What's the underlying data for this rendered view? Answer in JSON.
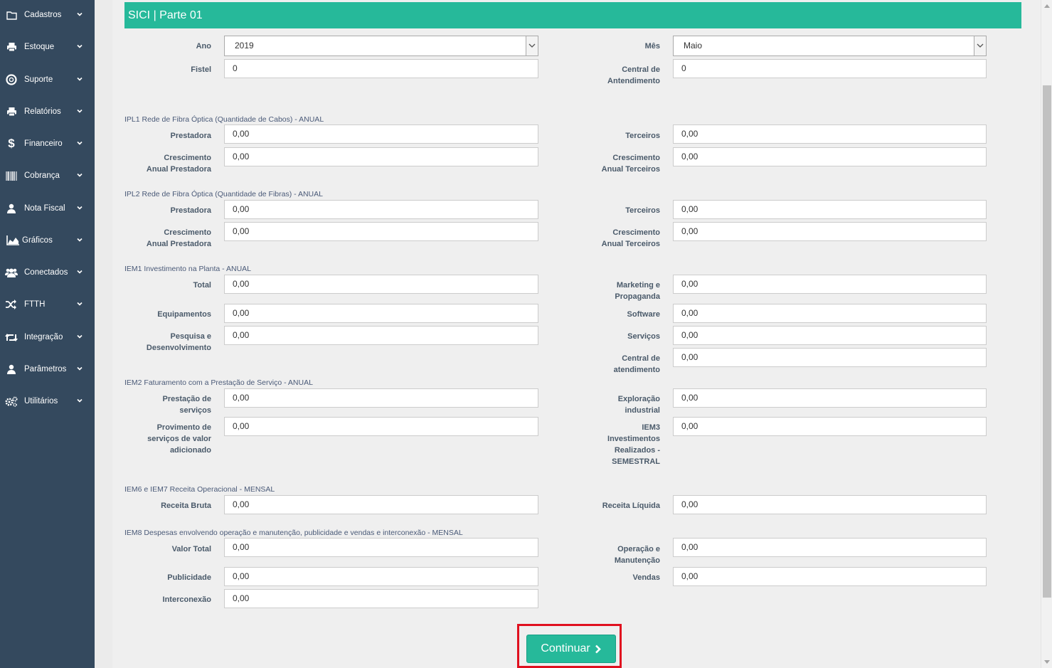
{
  "sidebar": {
    "items": [
      {
        "label": "Cadastros",
        "icon": "folder-icon"
      },
      {
        "label": "Estoque",
        "icon": "print-icon"
      },
      {
        "label": "Suporte",
        "icon": "life-ring-icon"
      },
      {
        "label": "Relatórios",
        "icon": "print-icon"
      },
      {
        "label": "Financeiro",
        "icon": "dollar-icon"
      },
      {
        "label": "Cobrança",
        "icon": "barcode-icon"
      },
      {
        "label": "Nota Fiscal",
        "icon": "user-icon"
      },
      {
        "label": "Gráficos",
        "icon": "area-chart-icon"
      },
      {
        "label": "Conectados",
        "icon": "users-icon"
      },
      {
        "label": "FTTH",
        "icon": "random-icon"
      },
      {
        "label": "Integração",
        "icon": "retweet-icon"
      },
      {
        "label": "Parâmetros",
        "icon": "user-icon"
      },
      {
        "label": "Utilitários",
        "icon": "cogs-icon"
      }
    ]
  },
  "panel": {
    "title": "SICI | Parte 01"
  },
  "form": {
    "ano": {
      "label": "Ano",
      "value": "2019"
    },
    "mes": {
      "label": "Mês",
      "value": "Maio"
    },
    "fistel": {
      "label": "Fistel",
      "value": "0"
    },
    "central": {
      "label_1": "Central de",
      "label_2": "Antendimento",
      "value": "0"
    },
    "ipl1": {
      "section": "IPL1 Rede de Fibra Óptica (Quantidade de Cabos) - ANUAL",
      "prestadora": {
        "label": "Prestadora",
        "value": "0,00"
      },
      "terceiros": {
        "label": "Terceiros",
        "value": "0,00"
      },
      "cresc_prest": {
        "label_1": "Crescimento",
        "label_2": "Anual Prestadora",
        "value": "0,00"
      },
      "cresc_terc": {
        "label_1": "Crescimento",
        "label_2": "Anual Terceiros",
        "value": "0,00"
      }
    },
    "ipl2": {
      "section": "IPL2 Rede de Fibra Óptica (Quantidade de Fibras) - ANUAL",
      "prestadora": {
        "label": "Prestadora",
        "value": "0,00"
      },
      "terceiros": {
        "label": "Terceiros",
        "value": "0,00"
      },
      "cresc_prest": {
        "label_1": "Crescimento",
        "label_2": "Anual Prestadora",
        "value": "0,00"
      },
      "cresc_terc": {
        "label_1": "Crescimento",
        "label_2": "Anual Terceiros",
        "value": "0,00"
      }
    },
    "iem1": {
      "section": "IEM1 Investimento na Planta - ANUAL",
      "total": {
        "label": "Total",
        "value": "0,00"
      },
      "marketing": {
        "label_1": "Marketing e",
        "label_2": "Propaganda",
        "value": "0,00"
      },
      "equipamentos": {
        "label": "Equipamentos",
        "value": "0,00"
      },
      "software": {
        "label": "Software",
        "value": "0,00"
      },
      "pesquisa": {
        "label_1": "Pesquisa e",
        "label_2": "Desenvolvimento",
        "value": "0,00"
      },
      "servicos": {
        "label": "Serviços",
        "value": "0,00"
      },
      "central": {
        "label_1": "Central de",
        "label_2": "atendimento",
        "value": "0,00"
      }
    },
    "iem2": {
      "section": "IEM2 Faturamento com a Prestação de Serviço - ANUAL",
      "prestacao": {
        "label_1": "Prestação de",
        "label_2": "serviços",
        "value": "0,00"
      },
      "exploracao": {
        "label_1": "Exploração",
        "label_2": "industrial",
        "value": "0,00"
      },
      "provimento": {
        "label_1": "Provimento de",
        "label_2": "serviços de valor",
        "label_3": "adicionado",
        "value": "0,00"
      },
      "iem3": {
        "label_1": "IEM3",
        "label_2": "Investimentos",
        "label_3": "Realizados -",
        "label_4": "SEMESTRAL",
        "value": "0,00"
      }
    },
    "iem6": {
      "section": "IEM6 e IEM7 Receita Operacional - MENSAL",
      "bruta": {
        "label": "Receita Bruta",
        "value": "0,00"
      },
      "liquida": {
        "label": "Receita Líquida",
        "value": "0,00"
      }
    },
    "iem8": {
      "section": "IEM8 Despesas envolvendo operação e manutenção, publicidade e vendas e interconexão - MENSAL",
      "valor_total": {
        "label": "Valor Total",
        "value": "0,00"
      },
      "operacao": {
        "label_1": "Operação e",
        "label_2": "Manutenção",
        "value": "0,00"
      },
      "publicidade": {
        "label": "Publicidade",
        "value": "0,00"
      },
      "vendas": {
        "label": "Vendas",
        "value": "0,00"
      },
      "interconexao": {
        "label": "Interconexão",
        "value": "0,00"
      }
    }
  },
  "actions": {
    "continue_label": "Continuar"
  },
  "colors": {
    "sidebar": "#34495e",
    "accent": "#26b99a",
    "highlight": "#e0101f"
  }
}
